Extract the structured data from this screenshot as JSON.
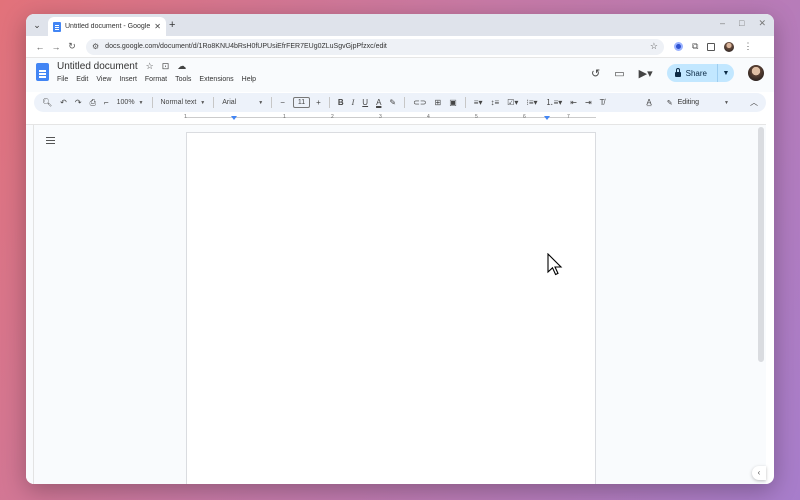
{
  "browser": {
    "tab_title": "Untitled document - Google Docs",
    "url": "docs.google.com/document/d/1Ro8KNU4bRsH0fUPUsiEfrFER7EUg0ZLuSgvGjpPfzxc/edit",
    "window_controls": [
      "–",
      "□",
      "✕"
    ]
  },
  "docs": {
    "doc_title": "Untitled document",
    "menus": [
      "File",
      "Edit",
      "View",
      "Insert",
      "Format",
      "Tools",
      "Extensions",
      "Help"
    ],
    "share_label": "Share"
  },
  "toolbar": {
    "zoom": "100%",
    "style": "Normal text",
    "font": "Arial",
    "font_size": "11",
    "mode": "Editing"
  },
  "ruler": {
    "numbers": [
      "1",
      "1",
      "2",
      "3",
      "4",
      "5",
      "6",
      "7"
    ]
  },
  "colors": {
    "accent": "#4285f4",
    "share_bg": "#c2e7ff",
    "toolbar_bg": "#edf2fa"
  }
}
